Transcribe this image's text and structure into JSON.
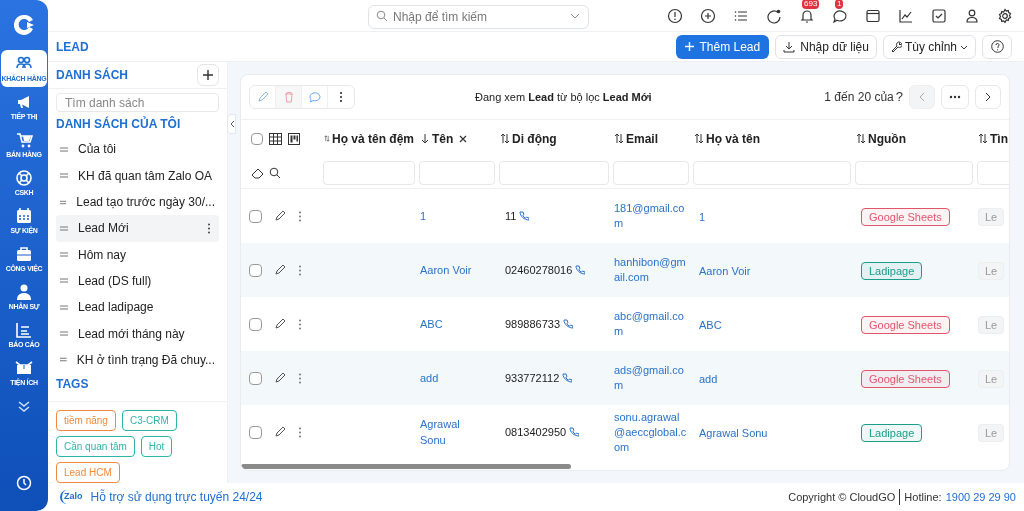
{
  "nav": [
    {
      "label": "KHÁCH HÀNG",
      "selected": true
    },
    {
      "label": "TIẾP THỊ",
      "selected": false
    },
    {
      "label": "BÁN HÀNG",
      "selected": false
    },
    {
      "label": "CSKH",
      "selected": false
    },
    {
      "label": "SỰ KIỆN",
      "selected": false
    },
    {
      "label": "CÔNG VIỆC",
      "selected": false
    },
    {
      "label": "NHÂN SỰ",
      "selected": false
    },
    {
      "label": "BÁO CÁO",
      "selected": false
    },
    {
      "label": "TIỆN ÍCH",
      "selected": false
    }
  ],
  "search": {
    "placeholder": "Nhập để tìm kiếm"
  },
  "notification_count": "693",
  "message_count": "1",
  "page_title": "LEAD",
  "actions": [
    {
      "label": "Thêm Lead",
      "kind": "primary"
    },
    {
      "label": "Nhập dữ liệu",
      "kind": "import"
    },
    {
      "label": "Tùy chỉnh",
      "kind": "dropdown"
    },
    {
      "kind": "help"
    }
  ],
  "sidebar": {
    "title": "DANH SÁCH",
    "search_placeholder": "Tìm danh sách",
    "my_lists_title": "DANH SÁCH CỦA TÔI",
    "items": [
      {
        "label": "Của tôi",
        "selected": false
      },
      {
        "label": "KH đã quan tâm Zalo OA",
        "selected": false
      },
      {
        "label": "Lead tạo trước ngày 30/...",
        "selected": false
      },
      {
        "label": "Lead Mới",
        "selected": true
      },
      {
        "label": "Hôm nay",
        "selected": false
      },
      {
        "label": "Lead (DS full)",
        "selected": false
      },
      {
        "label": "Lead ladipage",
        "selected": false
      },
      {
        "label": "Lead mới tháng này",
        "selected": false
      },
      {
        "label": "KH ở tình trạng Đã chuy...",
        "selected": false
      }
    ],
    "tags_title": "TAGS",
    "tags": [
      {
        "label": "tiềm năng",
        "color": "#f08a3c"
      },
      {
        "label": "C3-CRM",
        "color": "#2cb5a8"
      },
      {
        "label": "Cần quan tâm",
        "color": "#2cb5a8"
      },
      {
        "label": "Hot",
        "color": "#2cb5a8"
      },
      {
        "label": "Lead HCM",
        "color": "#f08a3c"
      }
    ]
  },
  "filter_info": "Đang xem **Lead** từ bộ lọc **Lead Mới**",
  "pagination": "1 đến 20 của",
  "pagination_q": "?",
  "table": {
    "all_checked": false,
    "columns": [
      {
        "label": "Họ và tên đệm"
      },
      {
        "label": "Tên"
      },
      {
        "label": "Di động"
      },
      {
        "label": "Email"
      },
      {
        "label": "Họ và tên"
      },
      {
        "label": "Nguồn"
      },
      {
        "label": "Tìn"
      }
    ],
    "rows": [
      {
        "checked": false,
        "ten": "1",
        "mobile": "11",
        "email": "181@gmail.com",
        "full_name": "1",
        "source": {
          "label": "Google Sheets",
          "color": "#e0566b"
        },
        "column_8": "Le"
      },
      {
        "checked": false,
        "ten": "Aaron Voir",
        "mobile": "02460278016",
        "email": "hanhibon@gmail.com",
        "full_name": "Aaron Voir",
        "source": {
          "label": "Ladipage",
          "color": "#1a9e8a"
        },
        "column_8": "Le"
      },
      {
        "checked": false,
        "ten": "ABC",
        "mobile": "989886733",
        "email": "abc@gmail.com",
        "full_name": "ABC",
        "source": {
          "label": "Google Sheets",
          "color": "#e0566b"
        },
        "column_8": "Le"
      },
      {
        "checked": false,
        "ten": "add",
        "mobile": "933772112",
        "email": "ads@gmail.com",
        "full_name": "add",
        "source": {
          "label": "Google Sheets",
          "color": "#e0566b"
        },
        "column_8": "Le"
      },
      {
        "checked": false,
        "ten": "Agrawal Sonu",
        "mobile": "0813402950",
        "email": "sonu.agrawal@aeccglobal.com",
        "full_name": "Agrawal Sonu",
        "source": {
          "label": "Ladipage",
          "color": "#1a9e8a"
        },
        "column_8": "Le"
      }
    ]
  },
  "support": "Hỗ trợ sử dụng trực tuyến 24/24",
  "zalo": "Zalo",
  "copyright": "Copyright © CloudGO",
  "hotline_label": "Hotline:",
  "hotline": "1900 29 29 90"
}
